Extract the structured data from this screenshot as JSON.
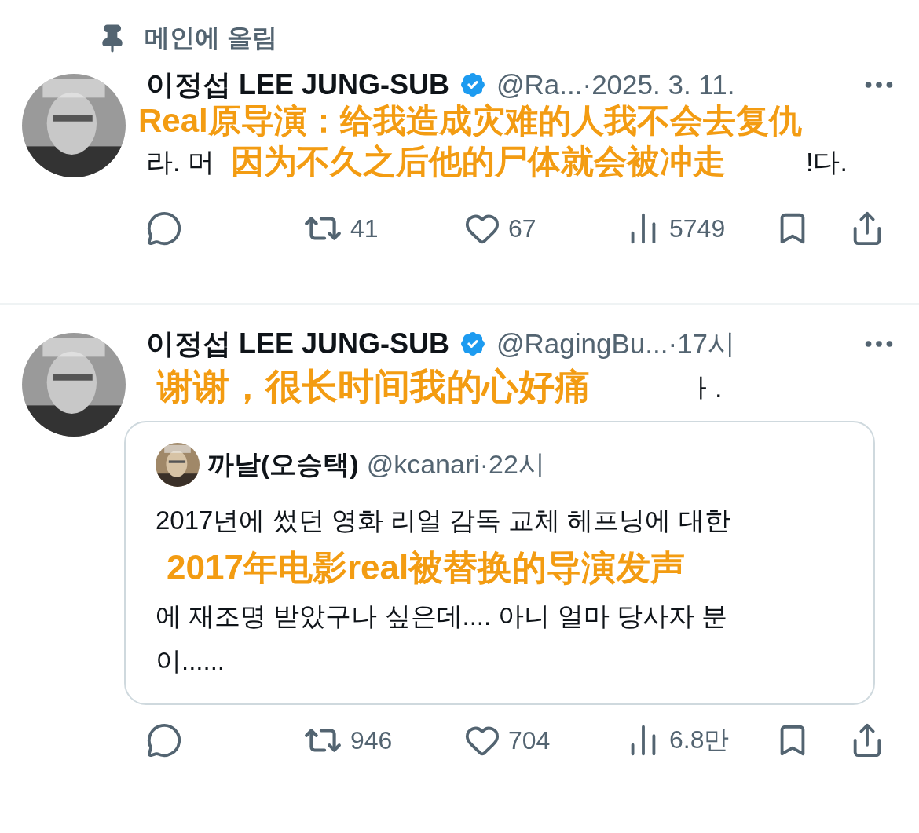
{
  "pinned_label": "메인에 올림",
  "posts": [
    {
      "author": "이정섭 LEE JUNG-SUB",
      "verified": true,
      "meta": "@Ra...·2025. 3. 11.",
      "body_fragments": [
        "라. 머",
        "!다."
      ],
      "captions": [
        "Real原导演：给我造成灾难的人我不会去复仇",
        "因为不久之后他的尸体就会被冲走"
      ],
      "actions": {
        "reposts": "41",
        "likes": "67",
        "views": "5749"
      }
    },
    {
      "author": "이정섭 LEE JUNG-SUB",
      "verified": true,
      "meta": "@RagingBu...·17시",
      "body_fragments": [
        "ㅏ."
      ],
      "captions": [
        "谢谢，很长时间我的心好痛"
      ],
      "quote": {
        "author": "까날(오승택)",
        "meta": "@kcanari·22시",
        "lines": [
          "2017년에 썼던 영화 리얼 감독 교체 헤프닝에 대한",
          "에 재조명 받았구나 싶은데.... 아니 얼마 당사자 분",
          "이......"
        ],
        "caption": "2017年电影real被替换的导演发声"
      },
      "actions": {
        "reposts": "946",
        "likes": "704",
        "views": "6.8만"
      }
    }
  ]
}
